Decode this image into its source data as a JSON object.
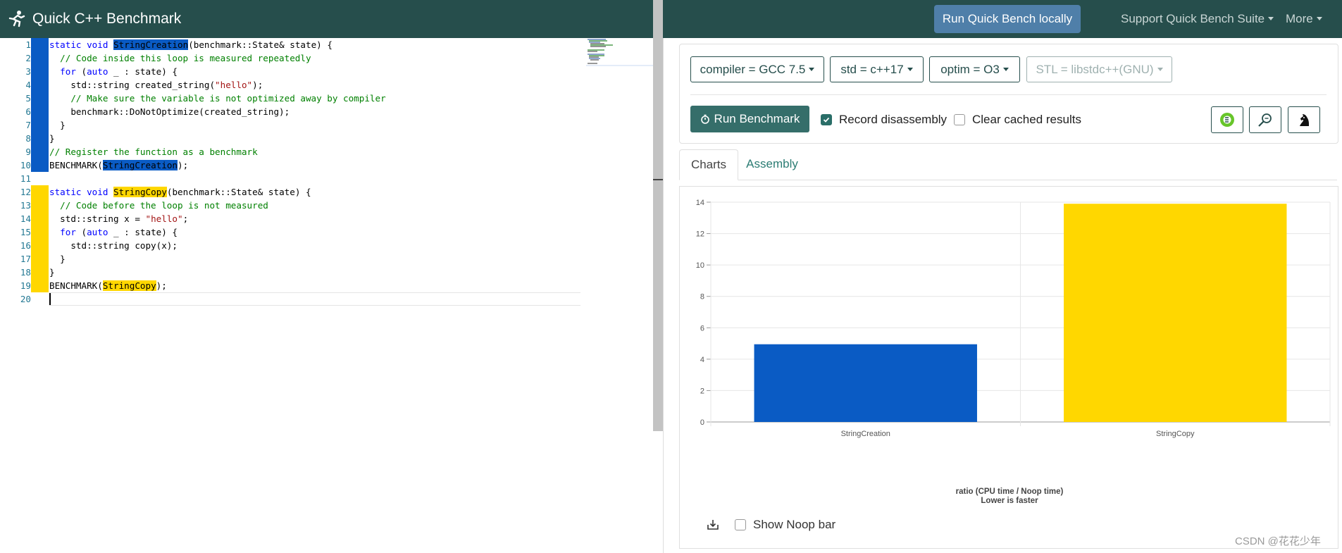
{
  "app": {
    "title": "Quick C++ Benchmark",
    "logo_icon": "runner-icon"
  },
  "nav": {
    "run_locally": "Run Quick Bench locally",
    "support": "Support Quick Bench Suite",
    "more": "More"
  },
  "editor": {
    "line_numbers": [
      "1",
      "2",
      "3",
      "4",
      "5",
      "6",
      "7",
      "8",
      "9",
      "10",
      "11",
      "12",
      "13",
      "14",
      "15",
      "16",
      "17",
      "18",
      "19",
      "20"
    ],
    "line1": {
      "kw1": "static",
      "kw2": "void",
      "fn": "StringCreation",
      "rest": "(benchmark::State& state) {"
    },
    "line2": "  // Code inside this loop is measured repeatedly",
    "line3": {
      "kw": "for",
      "kw2": "auto",
      "rest": " _ : state) {"
    },
    "line4": {
      "pre": "    std::string created_string(",
      "str": "\"hello\"",
      "post": ");"
    },
    "line5": "    // Make sure the variable is not optimized away by compiler",
    "line6": "    benchmark::DoNotOptimize(created_string);",
    "line7": "  }",
    "line8": "}",
    "line9": "// Register the function as a benchmark",
    "line10": {
      "pre": "BENCHMARK(",
      "fn": "StringCreation",
      "post": ");"
    },
    "line12": {
      "kw1": "static",
      "kw2": "void",
      "fn": "StringCopy",
      "rest": "(benchmark::State& state) {"
    },
    "line13": "  // Code before the loop is not measured",
    "line14": {
      "pre": "  std::string x = ",
      "str": "\"hello\"",
      "post": ";"
    },
    "line15": {
      "kw": "for",
      "kw2": "auto",
      "rest": " _ : state) {"
    },
    "line16": "    std::string copy(x);",
    "line17": "  }",
    "line18": "}",
    "line19": {
      "pre": "BENCHMARK(",
      "fn": "StringCopy",
      "post": ");"
    }
  },
  "options": {
    "compiler": "compiler = GCC 7.5",
    "std": "std = c++17",
    "optim": "optim = O3",
    "stl": "STL = libstdc++(GNU)"
  },
  "actions": {
    "run": "Run Benchmark",
    "record_disassembly": "Record disassembly",
    "record_disassembly_checked": true,
    "clear_cached": "Clear cached results",
    "clear_cached_checked": false
  },
  "tabs": {
    "charts": "Charts",
    "assembly": "Assembly",
    "active": "Charts"
  },
  "chart_footer": {
    "show_noop": "Show Noop bar",
    "show_noop_checked": false
  },
  "chart_data": {
    "type": "bar",
    "categories": [
      "StringCreation",
      "StringCopy"
    ],
    "values": [
      4.95,
      13.9
    ],
    "colors": [
      "#0a5bc4",
      "#ffd700"
    ],
    "ylim": [
      0,
      14
    ],
    "yticks": [
      "0",
      "2",
      "4",
      "6",
      "8",
      "10",
      "12",
      "14"
    ],
    "xlabel": "ratio (CPU time / Noop time)",
    "xlabel2": "Lower is faster",
    "grid": true
  },
  "watermark": "CSDN @花花少年"
}
